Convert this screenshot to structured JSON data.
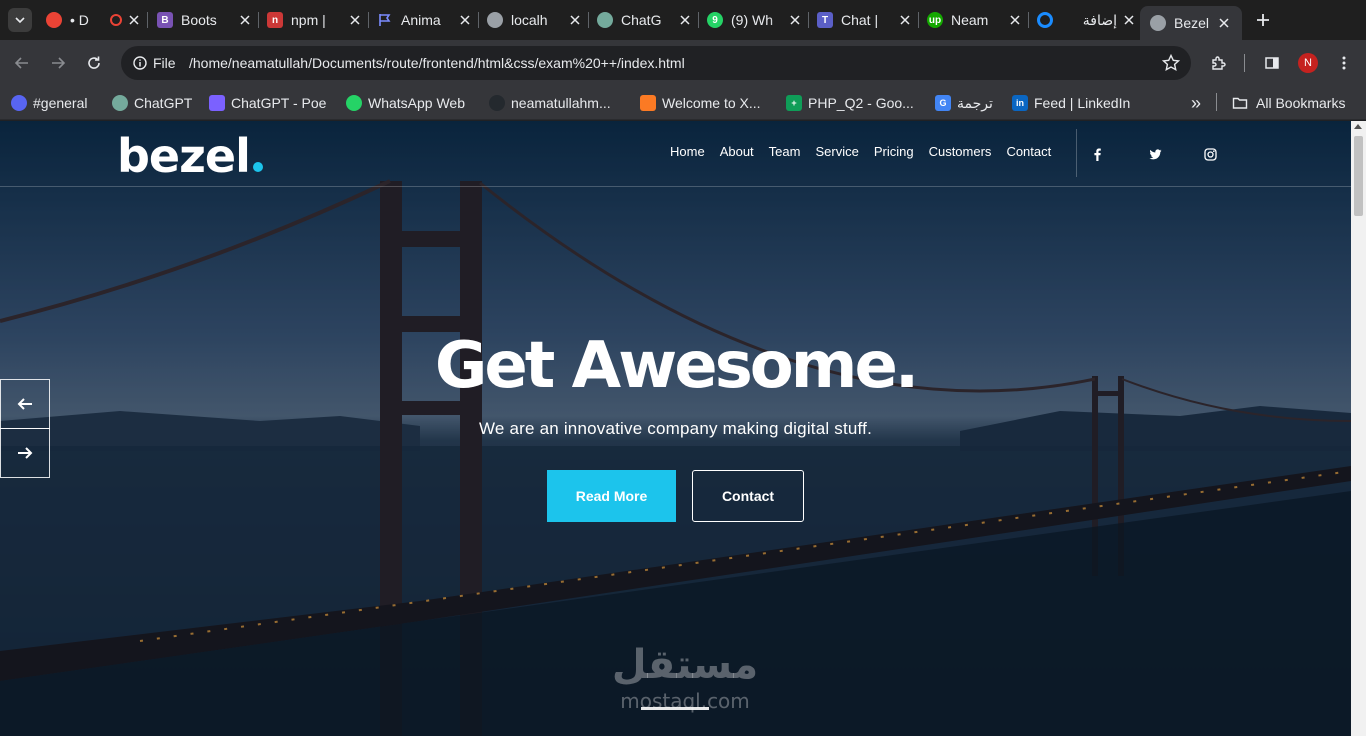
{
  "browser": {
    "tabs": [
      {
        "label": "• D",
        "icon": "google-red-icon",
        "color": "#ea4335",
        "active": false
      },
      {
        "label": "Boots",
        "icon": "bootstrap-icon",
        "color": "#7952b3",
        "active": false
      },
      {
        "label": "npm |",
        "icon": "npm-icon",
        "color": "#cb3837",
        "active": false
      },
      {
        "label": "Anima",
        "icon": "flag-icon",
        "color": "#4f6cf5",
        "active": false
      },
      {
        "label": "localh",
        "icon": "globe-icon",
        "color": "#9aa0a6",
        "active": false
      },
      {
        "label": "ChatG",
        "icon": "chatgpt-icon",
        "color": "#74aa9c",
        "active": false
      },
      {
        "label": "(9) Wh",
        "icon": "whatsapp-icon",
        "color": "#25d366",
        "active": false
      },
      {
        "label": "Chat |",
        "icon": "teams-icon",
        "color": "#5b5fc7",
        "active": false
      },
      {
        "label": "Neam",
        "icon": "upwork-icon",
        "color": "#14a800",
        "active": false
      },
      {
        "label": "إضافة",
        "icon": "circle-icon",
        "color": "#1a8cff",
        "active": false
      },
      {
        "label": "Bezel",
        "icon": "globe-icon",
        "color": "#9aa0a6",
        "active": true
      }
    ],
    "chip_label": "File",
    "url": "/home/neamatullah/Documents/route/frontend/html&css/exam%20++/index.html",
    "profile_initial": "N"
  },
  "bookmarks": [
    {
      "label": "#general",
      "icon": "discord-icon",
      "color": "#5865f2"
    },
    {
      "label": "ChatGPT",
      "icon": "chatgpt-icon",
      "color": "#74aa9c"
    },
    {
      "label": "ChatGPT - Poe",
      "icon": "poe-icon",
      "color": "#7b61ff"
    },
    {
      "label": "WhatsApp Web",
      "icon": "whatsapp-icon",
      "color": "#25d366"
    },
    {
      "label": "neamatullahm...",
      "icon": "github-icon",
      "color": "#24292e"
    },
    {
      "label": "Welcome to X...",
      "icon": "xampp-icon",
      "color": "#fb7a24"
    },
    {
      "label": "PHP_Q2 - Goo...",
      "icon": "sheets-icon",
      "color": "#0f9d58"
    },
    {
      "label": "ترجمة",
      "icon": "translate-icon",
      "color": "#4285f4"
    },
    {
      "label": "Feed | LinkedIn",
      "icon": "linkedin-icon",
      "color": "#0a66c2"
    }
  ],
  "all_bookmarks": "All Bookmarks",
  "site": {
    "logo": "bezel",
    "accent": "#1cc4ec",
    "menu": [
      "Home",
      "About",
      "Team",
      "Service",
      "Pricing",
      "Customers",
      "Contact"
    ],
    "social": [
      "facebook-icon",
      "twitter-icon",
      "instagram-icon"
    ],
    "hero_title": "Get Awesome.",
    "hero_subtitle": "We are an innovative company making digital stuff.",
    "btn_read_more": "Read More",
    "btn_contact": "Contact",
    "watermark_ar": "مستقل",
    "watermark_en": "mostaql.com"
  }
}
